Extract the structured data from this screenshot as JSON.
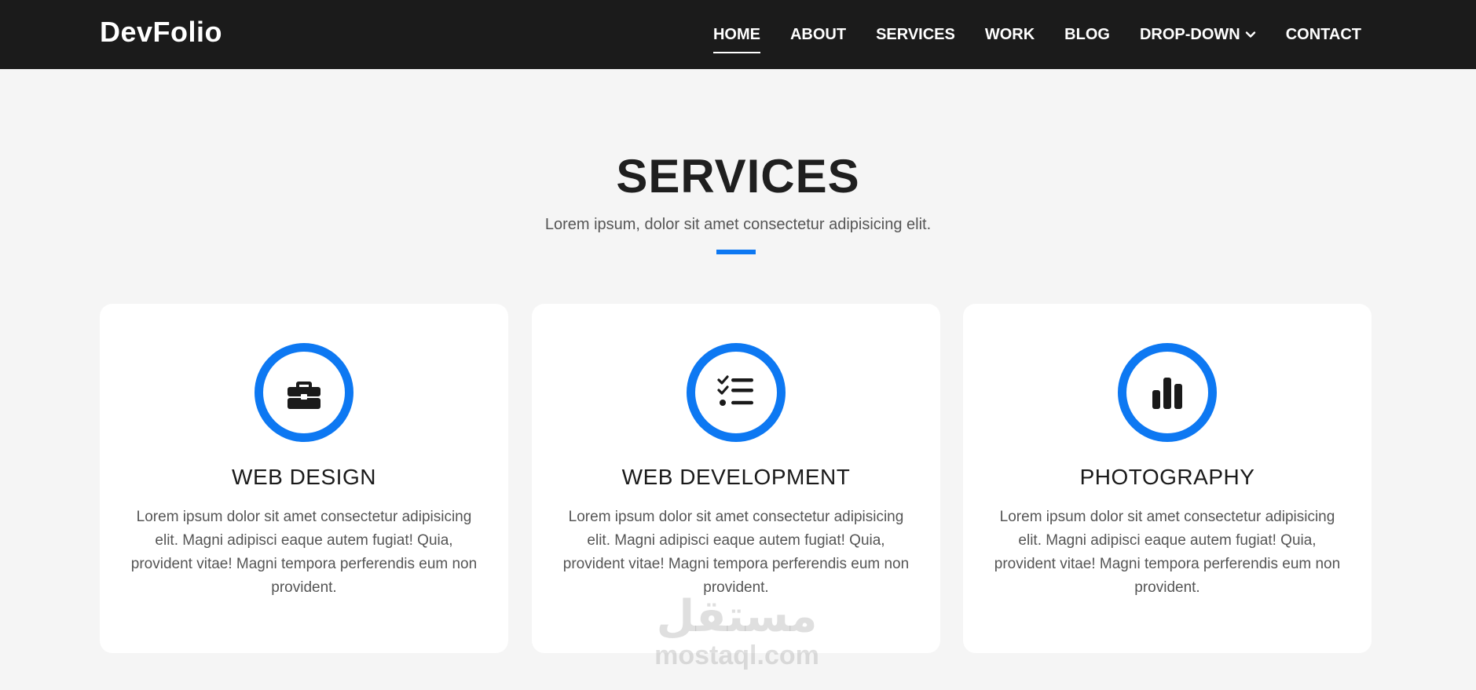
{
  "navbar": {
    "brand": "DevFolio",
    "links": [
      {
        "label": "HOME",
        "active": true
      },
      {
        "label": "ABOUT"
      },
      {
        "label": "SERVICES"
      },
      {
        "label": "WORK"
      },
      {
        "label": "BLOG"
      },
      {
        "label": "DROP-DOWN",
        "has_dropdown": true,
        "icon": "chevron-down-icon"
      },
      {
        "label": "CONTACT"
      }
    ]
  },
  "services": {
    "title": "SERVICES",
    "subtitle": "Lorem ipsum, dolor sit amet consectetur adipisicing elit.",
    "cards": [
      {
        "icon": "briefcase-icon",
        "title": "WEB DESIGN",
        "text": "Lorem ipsum dolor sit amet consectetur adipisicing elit. Magni adipisci eaque autem fugiat! Quia, provident vitae! Magni tempora perferendis eum non provident."
      },
      {
        "icon": "checklist-icon",
        "title": "WEB DEVELOPMENT",
        "text": "Lorem ipsum dolor sit amet consectetur adipisicing elit. Magni adipisci eaque autem fugiat! Quia, provident vitae! Magni tempora perferendis eum non provident."
      },
      {
        "icon": "bar-chart-icon",
        "title": "PHOTOGRAPHY",
        "text": "Lorem ipsum dolor sit amet consectetur adipisicing elit. Magni adipisci eaque autem fugiat! Quia, provident vitae! Magni tempora perferendis eum non provident."
      }
    ]
  },
  "watermark": {
    "arabic": "مستقل",
    "latin": "mostaql.com"
  },
  "colors": {
    "navbar_bg": "#1b1b1b",
    "page_bg": "#f5f5f5",
    "accent": "#0d78f2",
    "card_bg": "#ffffff"
  }
}
